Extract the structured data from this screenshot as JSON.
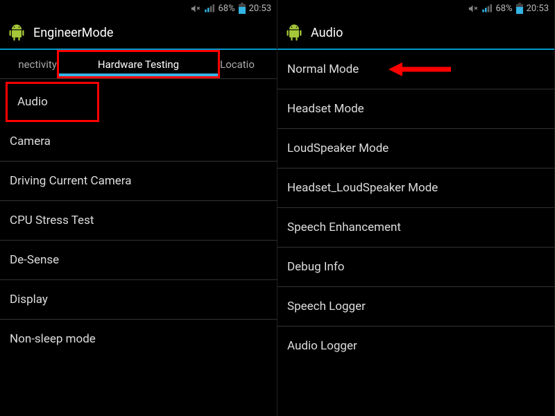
{
  "status": {
    "battery": "68%",
    "time": "20:53"
  },
  "left": {
    "title": "EngineerMode",
    "tabs": {
      "prev": "nectivity",
      "active": "Hardware Testing",
      "next": "Locatio"
    },
    "items": [
      "Audio",
      "Camera",
      "Driving Current Camera",
      "CPU Stress Test",
      "De-Sense",
      "Display",
      "Non-sleep mode"
    ]
  },
  "right": {
    "title": "Audio",
    "items": [
      "Normal Mode",
      "Headset Mode",
      "LoudSpeaker Mode",
      "Headset_LoudSpeaker Mode",
      "Speech Enhancement",
      "Debug Info",
      "Speech Logger",
      "Audio Logger"
    ]
  }
}
